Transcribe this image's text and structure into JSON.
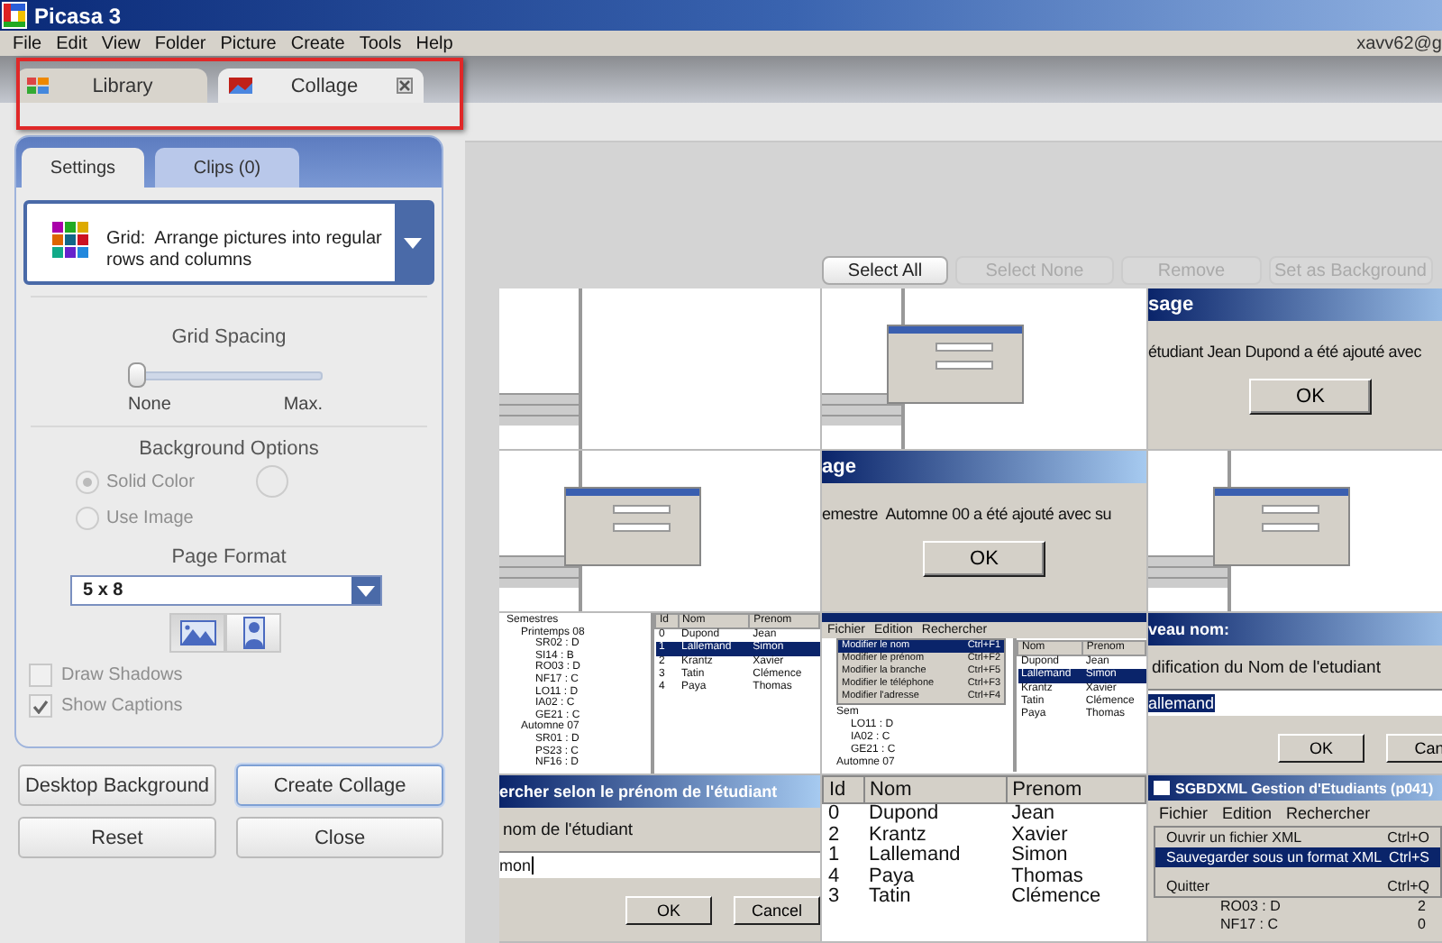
{
  "window": {
    "title": "Picasa 3"
  },
  "menu": [
    "File",
    "Edit",
    "View",
    "Folder",
    "Picture",
    "Create",
    "Tools",
    "Help"
  ],
  "account": "xavv62@g",
  "tabs": [
    {
      "label": "Library",
      "selected": false,
      "closable": false
    },
    {
      "label": "Collage",
      "selected": true,
      "closable": true
    }
  ],
  "panel": {
    "tabs": [
      {
        "label": "Settings",
        "selected": true
      },
      {
        "label": "Clips (0)",
        "selected": false
      }
    ],
    "layout": {
      "name": "Grid:",
      "description": "Arrange pictures into regular rows and columns"
    },
    "grid_spacing": {
      "title": "Grid Spacing",
      "level": 0,
      "min_label": "None",
      "max_label": "Max."
    },
    "background": {
      "title": "Background Options",
      "disabled": true,
      "options": [
        {
          "label": "Solid Color",
          "selected": true
        },
        {
          "label": "Use Image",
          "selected": false
        }
      ]
    },
    "page_format": {
      "title": "Page Format",
      "value": "5 x 8",
      "orientations": [
        {
          "kind": "landscape",
          "selected": true
        },
        {
          "kind": "portrait",
          "selected": false
        }
      ]
    },
    "checkboxes": [
      {
        "label": "Draw Shadows",
        "checked": false,
        "disabled": true
      },
      {
        "label": "Show Captions",
        "checked": true,
        "disabled": true
      }
    ]
  },
  "actions": [
    {
      "label": "Desktop Background",
      "primary": false
    },
    {
      "label": "Create Collage",
      "primary": true
    },
    {
      "label": "Reset",
      "primary": false
    },
    {
      "label": "Close",
      "primary": false
    }
  ],
  "selection_buttons": [
    {
      "label": "Select All",
      "disabled": false
    },
    {
      "label": "Select None",
      "disabled": true
    },
    {
      "label": "Remove",
      "disabled": true
    },
    {
      "label": "Set as Background",
      "disabled": true
    }
  ],
  "collage": {
    "tiles": [
      {
        "kind": "sketch",
        "dialog": false
      },
      {
        "kind": "sketch",
        "dialog": true
      },
      {
        "kind": "message",
        "title": "sage",
        "text": "étudiant Jean Dupond a été ajouté avec",
        "button": "OK"
      },
      {
        "kind": "sketch",
        "dialog": true
      },
      {
        "kind": "message",
        "title": "age",
        "text": "emestre  Automne 00 a été ajouté avec su",
        "button": "OK"
      },
      {
        "kind": "sketch",
        "dialog": true
      },
      {
        "kind": "tree_table",
        "tree": [
          {
            "label": "Semestres",
            "children": [
              {
                "label": "Printemps 08",
                "children": [
                  {
                    "label": "SR02 : D"
                  },
                  {
                    "label": "SI14 : B"
                  },
                  {
                    "label": "RO03 : D"
                  },
                  {
                    "label": "NF17 : C"
                  },
                  {
                    "label": "LO11 : D"
                  },
                  {
                    "label": "IA02 : C"
                  },
                  {
                    "label": "GE21 : C"
                  }
                ]
              },
              {
                "label": "Automne 07",
                "children": [
                  {
                    "label": "SR01 : D"
                  },
                  {
                    "label": "PS23 : C"
                  },
                  {
                    "label": "NF16 : D"
                  }
                ]
              }
            ]
          }
        ],
        "columns": [
          "Id",
          "Nom",
          "Prenom"
        ],
        "rows": [
          {
            "cells": [
              "0",
              "Dupond",
              "Jean"
            ],
            "selected": false
          },
          {
            "cells": [
              "1",
              "Lallemand",
              "Simon"
            ],
            "selected": true
          },
          {
            "cells": [
              "2",
              "Krantz",
              "Xavier"
            ],
            "selected": false
          },
          {
            "cells": [
              "3",
              "Tatin",
              "Clémence"
            ],
            "selected": false
          },
          {
            "cells": [
              "4",
              "Paya",
              "Thomas"
            ],
            "selected": false
          }
        ]
      },
      {
        "kind": "menu_table",
        "menubar": [
          "Fichier",
          "Edition",
          "Rechercher"
        ],
        "menu": [
          {
            "label": "Modifier le nom",
            "shortcut": "Ctrl+F1",
            "selected": true
          },
          {
            "label": "Modifier le prénom",
            "shortcut": "Ctrl+F2",
            "selected": false
          },
          {
            "label": "Modifier la branche",
            "shortcut": "Ctrl+F5",
            "selected": false
          },
          {
            "label": "Modifier le téléphone",
            "shortcut": "Ctrl+F3",
            "selected": false
          },
          {
            "label": "Modifier l'adresse",
            "shortcut": "Ctrl+F4",
            "selected": false
          }
        ],
        "tree": [
          {
            "label": "Sem",
            "children": [
              {
                "label": "LO11 : D"
              },
              {
                "label": "IA02 : C"
              },
              {
                "label": "GE21 : C"
              }
            ]
          },
          {
            "label": "Automne 07"
          }
        ],
        "columns": [
          "Nom",
          "Prenom"
        ],
        "rows": [
          {
            "cells": [
              "Dupond",
              "Jean"
            ],
            "selected": false
          },
          {
            "cells": [
              "Lallemand",
              "Simon"
            ],
            "selected": true
          },
          {
            "cells": [
              "Krantz",
              "Xavier"
            ],
            "selected": false
          },
          {
            "cells": [
              "Tatin",
              "Clémence"
            ],
            "selected": false
          },
          {
            "cells": [
              "Paya",
              "Thomas"
            ],
            "selected": false
          }
        ]
      },
      {
        "kind": "prompt",
        "title": "veau nom:",
        "text": "dification du Nom de l'etudiant",
        "value": "allemand",
        "value_selected": true,
        "buttons": [
          "OK",
          "Can"
        ]
      },
      {
        "kind": "prompt",
        "title": "ercher selon le prénom de l'étudiant",
        "text": "nom de l'étudiant",
        "value": "mon",
        "value_selected": false,
        "buttons": [
          "OK",
          "Cancel"
        ]
      },
      {
        "kind": "table",
        "columns": [
          "Id",
          "Nom",
          "Prenom"
        ],
        "rows": [
          {
            "cells": [
              "0",
              "Dupond",
              "Jean"
            ],
            "selected": false
          },
          {
            "cells": [
              "2",
              "Krantz",
              "Xavier"
            ],
            "selected": false
          },
          {
            "cells": [
              "1",
              "Lallemand",
              "Simon"
            ],
            "selected": false
          },
          {
            "cells": [
              "4",
              "Paya",
              "Thomas"
            ],
            "selected": false
          },
          {
            "cells": [
              "3",
              "Tatin",
              "Clémence"
            ],
            "selected": false
          }
        ]
      },
      {
        "kind": "app_menu",
        "title": "SGBDXML Gestion d'Etudiants (p041)",
        "menubar": [
          "Fichier",
          "Edition",
          "Rechercher"
        ],
        "menu": [
          {
            "label": "Ouvrir un fichier XML",
            "shortcut": "Ctrl+O",
            "selected": false
          },
          {
            "label": "Sauvegarder sous un format XML",
            "shortcut": "Ctrl+S",
            "selected": true
          },
          {
            "label": "Quitter",
            "shortcut": "Ctrl+Q",
            "selected": false
          }
        ],
        "tree": [
          {
            "label": "RO03 : D"
          },
          {
            "label": "NF17 : C"
          }
        ],
        "values": [
          "2",
          "0"
        ]
      }
    ]
  }
}
